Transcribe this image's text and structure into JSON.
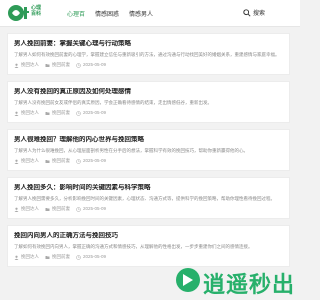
{
  "header": {
    "logo_text": "心理 百科",
    "nav": [
      {
        "label": "心理百",
        "active": true
      },
      {
        "label": "情感困惑",
        "active": false
      },
      {
        "label": "情感男人",
        "active": false
      }
    ],
    "search_label": "搜索"
  },
  "articles": [
    {
      "title": "男人挽回前妻：掌握关键心理与行动策略",
      "excerpt": "了解男人如何有效挽回前妻的心理学，掌握建立信任与重新吸引的方法，通过沟通与行动找回美好的婚姻关系，重建感情与家庭幸福。",
      "author": "挽回达人",
      "category": "挽回前妻",
      "date": "2025-05-09"
    },
    {
      "title": "男人没有挽回的真正原因及如何处理感情",
      "excerpt": "了解男人没有挽回前女友或伴侣的真实原因，学会正确看待感情的结束，走出情感低谷，重新出发。",
      "author": "挽回达人",
      "category": "挽回前妻",
      "date": "2025-05-09"
    },
    {
      "title": "男人很难挽回？理解他的内心世界与挽回策略",
      "excerpt": "了解男人为什么很难挽回，从心理层面剖析男性在分手后的想法，掌握科学有效的挽回技巧，帮助你重新赢得他的心。",
      "author": "挽回达人",
      "category": "挽回前妻",
      "date": "2025-05-09"
    },
    {
      "title": "男人挽回多久：影响时间的关键因素与科学策略",
      "excerpt": "了解男人挽回需要多久，分析影响挽回时间的关键因素，心理状态、沟通方式等，提供科学的挽回策略，帮助你理性看待挽回过程。",
      "author": "挽回达人",
      "category": "挽回前妻",
      "date": "2025-05-09"
    },
    {
      "title": "挽回内向男人的正确方法与挽回技巧",
      "excerpt": "了解如何有效挽回内向男人，掌握正确的沟通方式和情感技巧，从理解他的性格出发，一步步重建你们之间的感情连接。",
      "author": "挽回达人",
      "category": "挽回前妻",
      "date": "2025-05-09"
    }
  ],
  "watermark": {
    "text": "逍遥秒出"
  },
  "colors": {
    "accent": "#2e9b57",
    "watermark": "#27b06b"
  }
}
